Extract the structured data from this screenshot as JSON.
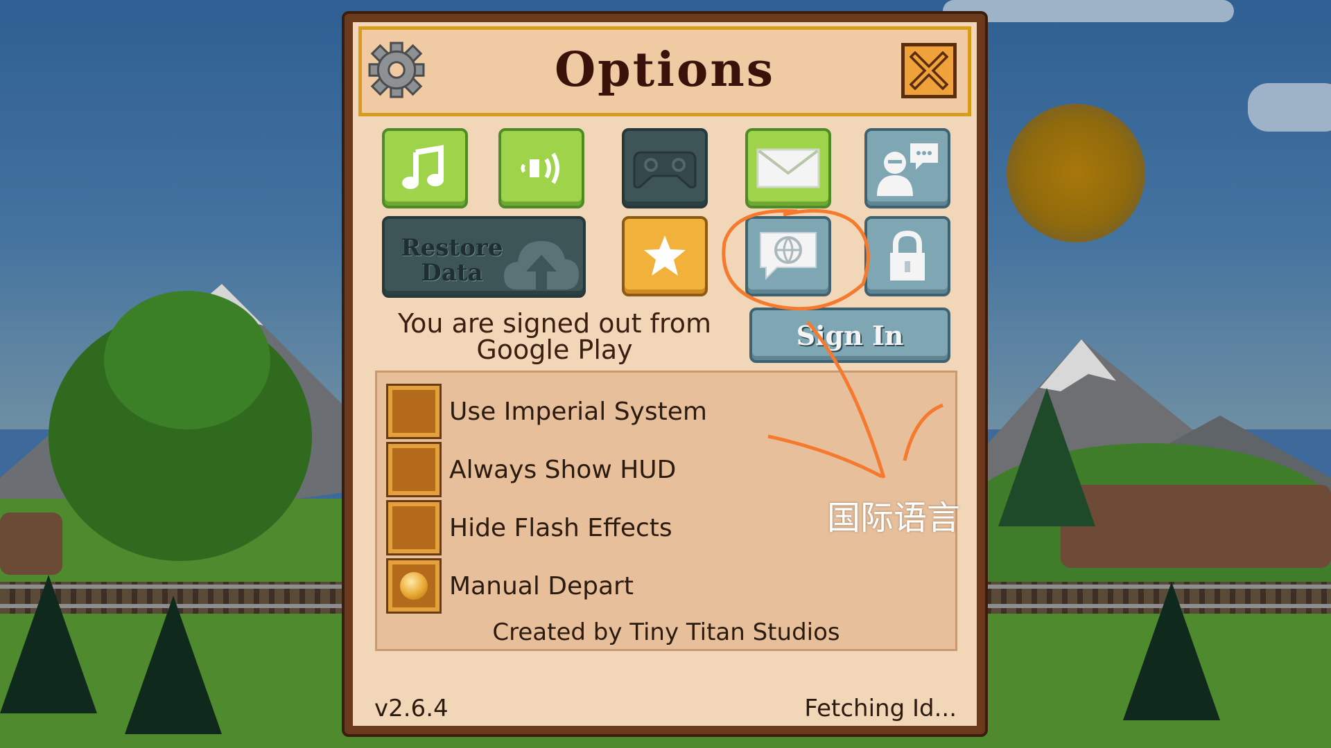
{
  "dialog": {
    "title": "Options",
    "close_icon": "x-icon"
  },
  "buttons": {
    "restore_label": "Restore\nData",
    "signin_label": "Sign In"
  },
  "account": {
    "status_text": "You are signed out from\nGoogle Play"
  },
  "options": [
    {
      "label": "Use Imperial System",
      "checked": false
    },
    {
      "label": "Always Show HUD",
      "checked": false
    },
    {
      "label": "Hide Flash Effects",
      "checked": false
    },
    {
      "label": "Manual Depart",
      "checked": true
    }
  ],
  "credits": "Created by Tiny Titan Studios",
  "footer": {
    "version": "v2.6.4",
    "status": "Fetching Id..."
  },
  "annotation": {
    "text": "国际语言",
    "color": "#f57a2e"
  },
  "icons": [
    "gear-icon",
    "music-icon",
    "sound-icon",
    "gamepad-icon",
    "mail-icon",
    "profile-chat-icon",
    "cloud-upload-icon",
    "star-icon",
    "language-icon",
    "lock-icon"
  ],
  "colors": {
    "panel_bg": "#f1d6b8",
    "accent_gold": "#d89c1c",
    "green_button": "#9fd44a",
    "blue_button": "#7fa6b3"
  }
}
